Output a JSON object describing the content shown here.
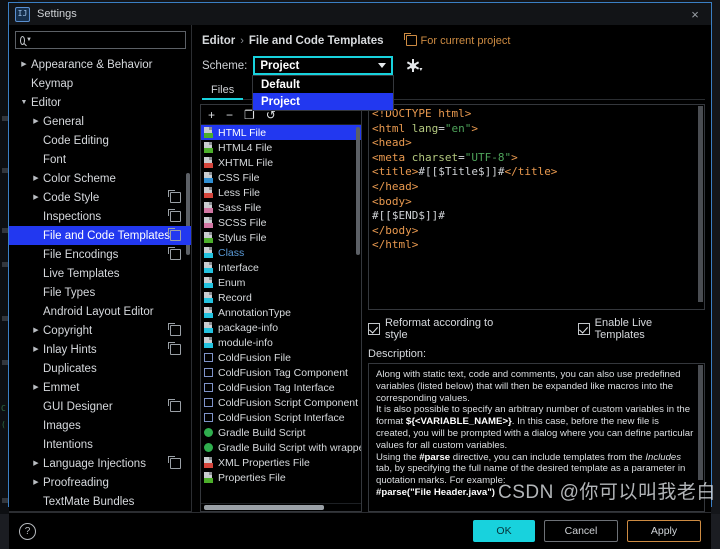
{
  "window": {
    "title": "Settings",
    "icon": "intellij-icon",
    "close_label": "×"
  },
  "search": {
    "value": "",
    "placeholder": "",
    "icon": "search-icon"
  },
  "sidebar": {
    "items": [
      {
        "label": "Appearance & Behavior",
        "indent": 0,
        "arrow": "▶",
        "copy": false,
        "selected": false
      },
      {
        "label": "Keymap",
        "indent": 0,
        "arrow": "",
        "copy": false,
        "selected": false
      },
      {
        "label": "Editor",
        "indent": 0,
        "arrow": "▼",
        "copy": false,
        "selected": false
      },
      {
        "label": "General",
        "indent": 1,
        "arrow": "▶",
        "copy": false,
        "selected": false
      },
      {
        "label": "Code Editing",
        "indent": 1,
        "arrow": "",
        "copy": false,
        "selected": false
      },
      {
        "label": "Font",
        "indent": 1,
        "arrow": "",
        "copy": false,
        "selected": false
      },
      {
        "label": "Color Scheme",
        "indent": 1,
        "arrow": "▶",
        "copy": false,
        "selected": false
      },
      {
        "label": "Code Style",
        "indent": 1,
        "arrow": "▶",
        "copy": true,
        "selected": false
      },
      {
        "label": "Inspections",
        "indent": 1,
        "arrow": "",
        "copy": true,
        "selected": false
      },
      {
        "label": "File and Code Templates",
        "indent": 1,
        "arrow": "",
        "copy": true,
        "selected": true
      },
      {
        "label": "File Encodings",
        "indent": 1,
        "arrow": "",
        "copy": true,
        "selected": false
      },
      {
        "label": "Live Templates",
        "indent": 1,
        "arrow": "",
        "copy": false,
        "selected": false
      },
      {
        "label": "File Types",
        "indent": 1,
        "arrow": "",
        "copy": false,
        "selected": false
      },
      {
        "label": "Android Layout Editor",
        "indent": 1,
        "arrow": "",
        "copy": false,
        "selected": false
      },
      {
        "label": "Copyright",
        "indent": 1,
        "arrow": "▶",
        "copy": true,
        "selected": false
      },
      {
        "label": "Inlay Hints",
        "indent": 1,
        "arrow": "▶",
        "copy": true,
        "selected": false
      },
      {
        "label": "Duplicates",
        "indent": 1,
        "arrow": "",
        "copy": false,
        "selected": false
      },
      {
        "label": "Emmet",
        "indent": 1,
        "arrow": "▶",
        "copy": false,
        "selected": false
      },
      {
        "label": "GUI Designer",
        "indent": 1,
        "arrow": "",
        "copy": true,
        "selected": false
      },
      {
        "label": "Images",
        "indent": 1,
        "arrow": "",
        "copy": false,
        "selected": false
      },
      {
        "label": "Intentions",
        "indent": 1,
        "arrow": "",
        "copy": false,
        "selected": false
      },
      {
        "label": "Language Injections",
        "indent": 1,
        "arrow": "▶",
        "copy": true,
        "selected": false
      },
      {
        "label": "Proofreading",
        "indent": 1,
        "arrow": "▶",
        "copy": false,
        "selected": false
      },
      {
        "label": "TextMate Bundles",
        "indent": 1,
        "arrow": "",
        "copy": false,
        "selected": false
      }
    ]
  },
  "breadcrumb": {
    "parent": "Editor",
    "separator": "›",
    "current": "File and Code Templates",
    "for_project": "For current project",
    "for_project_icon": "copy-icon"
  },
  "scheme": {
    "label": "Scheme:",
    "value": "Project",
    "gear_icon": "gear-icon",
    "options": [
      {
        "label": "Default",
        "highlighted": false
      },
      {
        "label": "Project",
        "highlighted": true
      }
    ]
  },
  "tabs": [
    {
      "label": "Files",
      "active": true
    }
  ],
  "template_toolbar": {
    "add": "+",
    "remove": "−",
    "copy": "❐",
    "reset": "↺"
  },
  "templates": [
    {
      "label": "HTML File",
      "icon": "html-file-icon",
      "kind": "file",
      "badge": "#4caf2b",
      "color": "#d7dadd",
      "selected": true
    },
    {
      "label": "HTML4 File",
      "icon": "html4-file-icon",
      "kind": "file",
      "badge": "#4caf2b",
      "color": "#d7dadd",
      "selected": false
    },
    {
      "label": "XHTML File",
      "icon": "xhtml-file-icon",
      "kind": "file",
      "badge": "#d4453c",
      "color": "#d7dadd",
      "selected": false
    },
    {
      "label": "CSS File",
      "icon": "css-file-icon",
      "kind": "file",
      "badge": "#2f8fd4",
      "color": "#d7dadd",
      "selected": false
    },
    {
      "label": "Less File",
      "icon": "less-file-icon",
      "kind": "file",
      "badge": "#d4453c",
      "color": "#d7dadd",
      "selected": false
    },
    {
      "label": "Sass File",
      "icon": "sass-file-icon",
      "kind": "file",
      "badge": "#d276a3",
      "color": "#d7dadd",
      "selected": false
    },
    {
      "label": "SCSS File",
      "icon": "scss-file-icon",
      "kind": "file",
      "badge": "#d276a3",
      "color": "#d7dadd",
      "selected": false
    },
    {
      "label": "Stylus File",
      "icon": "stylus-file-icon",
      "kind": "file",
      "badge": "#4caf2b",
      "color": "#d7dadd",
      "selected": false
    },
    {
      "label": "Class",
      "icon": "java-class-icon",
      "kind": "file",
      "badge": "#23c3e0",
      "color": "#5b9bd8",
      "selected": false
    },
    {
      "label": "Interface",
      "icon": "java-interface-icon",
      "kind": "file",
      "badge": "#23c3e0",
      "color": "#d7dadd",
      "selected": false
    },
    {
      "label": "Enum",
      "icon": "java-enum-icon",
      "kind": "file",
      "badge": "#23c3e0",
      "color": "#d7dadd",
      "selected": false
    },
    {
      "label": "Record",
      "icon": "java-record-icon",
      "kind": "file",
      "badge": "#23c3e0",
      "color": "#d7dadd",
      "selected": false
    },
    {
      "label": "AnnotationType",
      "icon": "java-annotation-icon",
      "kind": "file",
      "badge": "#23c3e0",
      "color": "#d7dadd",
      "selected": false
    },
    {
      "label": "package-info",
      "icon": "package-info-icon",
      "kind": "file",
      "badge": "#23c3e0",
      "color": "#d7dadd",
      "selected": false
    },
    {
      "label": "module-info",
      "icon": "module-info-icon",
      "kind": "file",
      "badge": "#23c3e0",
      "color": "#d7dadd",
      "selected": false
    },
    {
      "label": "ColdFusion File",
      "icon": "coldfusion-file-icon",
      "kind": "square",
      "badge": "#7f93c9",
      "color": "#d7dadd",
      "selected": false
    },
    {
      "label": "ColdFusion Tag Component",
      "icon": "coldfusion-tag-component-icon",
      "kind": "square",
      "badge": "#7f93c9",
      "color": "#d7dadd",
      "selected": false
    },
    {
      "label": "ColdFusion Tag Interface",
      "icon": "coldfusion-tag-interface-icon",
      "kind": "square",
      "badge": "#7f93c9",
      "color": "#d7dadd",
      "selected": false
    },
    {
      "label": "ColdFusion Script Component",
      "icon": "coldfusion-script-component-icon",
      "kind": "square",
      "badge": "#7f93c9",
      "color": "#d7dadd",
      "selected": false
    },
    {
      "label": "ColdFusion Script Interface",
      "icon": "coldfusion-script-interface-icon",
      "kind": "square",
      "badge": "#7f93c9",
      "color": "#d7dadd",
      "selected": false
    },
    {
      "label": "Gradle Build Script",
      "icon": "gradle-icon",
      "kind": "round",
      "badge": "#2fae4e",
      "color": "#d7dadd",
      "selected": false
    },
    {
      "label": "Gradle Build Script with wrapper",
      "icon": "gradle-wrapper-icon",
      "kind": "round",
      "badge": "#2fae4e",
      "color": "#d7dadd",
      "selected": false
    },
    {
      "label": "XML Properties File",
      "icon": "xml-properties-icon",
      "kind": "file",
      "badge": "#d4453c",
      "color": "#d7dadd",
      "selected": false
    },
    {
      "label": "Properties File",
      "icon": "properties-file-icon",
      "kind": "file",
      "badge": "#4caf2b",
      "color": "#d7dadd",
      "selected": false
    }
  ],
  "editor": {
    "lines": [
      [
        {
          "t": "<!DOCTYPE html>",
          "c": "k"
        }
      ],
      [
        {
          "t": "<html ",
          "c": "k"
        },
        {
          "t": "lang",
          "c": "at"
        },
        {
          "t": "=",
          "c": "m"
        },
        {
          "t": "\"en\"",
          "c": "v"
        },
        {
          "t": ">",
          "c": "k"
        }
      ],
      [
        {
          "t": "<head>",
          "c": "k"
        }
      ],
      [
        {
          "t": "  <meta ",
          "c": "k"
        },
        {
          "t": "charset",
          "c": "at"
        },
        {
          "t": "=",
          "c": "m"
        },
        {
          "t": "\"UTF-8\"",
          "c": "v"
        },
        {
          "t": ">",
          "c": "k"
        }
      ],
      [
        {
          "t": "  <title>",
          "c": "k"
        },
        {
          "t": "#[[$Title$]]#",
          "c": "t"
        },
        {
          "t": "</title>",
          "c": "k"
        }
      ],
      [
        {
          "t": "</head>",
          "c": "k"
        }
      ],
      [
        {
          "t": "<body>",
          "c": "k"
        }
      ],
      [
        {
          "t": "#[[$END$]]#",
          "c": "t"
        }
      ],
      [
        {
          "t": "</body>",
          "c": "k"
        }
      ],
      [
        {
          "t": "</html>",
          "c": "k"
        }
      ]
    ]
  },
  "options": {
    "reformat": {
      "label": "Reformat according to style",
      "checked": true
    },
    "live_templates": {
      "label": "Enable Live Templates",
      "checked": true
    }
  },
  "description": {
    "label": "Description:",
    "paragraphs": [
      "Along with static text, code and comments, you can also use predefined variables (listed below) that will then be expanded like macros into the corresponding values.",
      "It is also possible to specify an arbitrary number of custom variables in the format ${<VARIABLE_NAME>}. In this case, before the new file is created, you will be prompted with a dialog where you can define particular values for all custom variables.",
      "Using the #parse directive, you can include templates from the Includes tab, by specifying the full name of the desired template as a parameter in quotation marks. For example:",
      "#parse(\"File Header.java\")"
    ]
  },
  "footer": {
    "help_icon": "help-icon",
    "buttons": [
      {
        "label": "OK",
        "style": "ok"
      },
      {
        "label": "Cancel",
        "style": "default"
      },
      {
        "label": "Apply",
        "style": "apply"
      }
    ]
  },
  "watermark": {
    "text": "CSDN @你可以叫我老白"
  },
  "colors": {
    "accent": "#18d2dd",
    "selection": "#2238f0",
    "link": "#cd8b42"
  }
}
